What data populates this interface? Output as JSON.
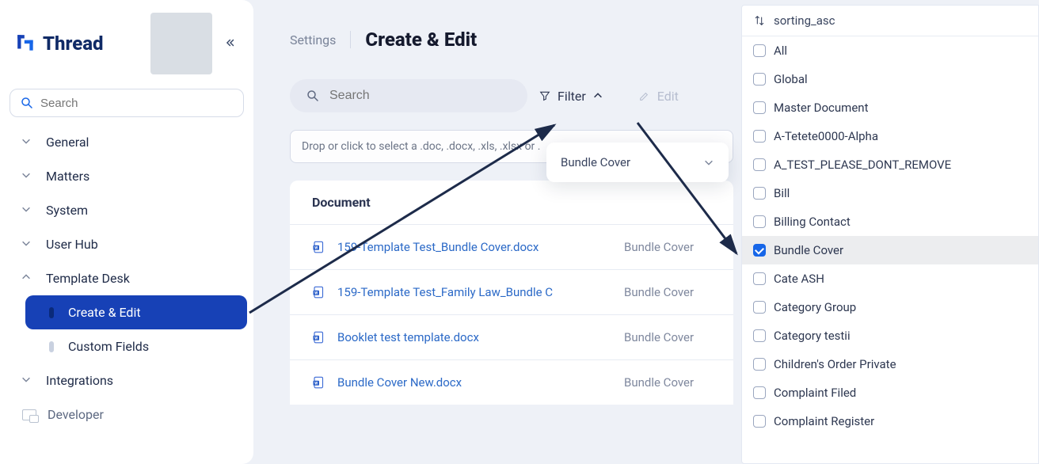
{
  "brand": {
    "name": "Thread"
  },
  "sidebar": {
    "search_placeholder": "Search",
    "items": [
      {
        "label": "General",
        "expanded": false
      },
      {
        "label": "Matters",
        "expanded": false
      },
      {
        "label": "System",
        "expanded": false
      },
      {
        "label": "User Hub",
        "expanded": false
      },
      {
        "label": "Template Desk",
        "expanded": true,
        "children": [
          {
            "label": "Create & Edit",
            "active": true
          },
          {
            "label": "Custom Fields",
            "active": false
          }
        ]
      },
      {
        "label": "Integrations",
        "expanded": false
      },
      {
        "label": "Developer",
        "expanded": false,
        "icon": "developer"
      }
    ]
  },
  "header": {
    "breadcrumb_root": "Settings",
    "page_title": "Create & Edit"
  },
  "toolbar": {
    "search_placeholder": "Search",
    "filter_label": "Filter",
    "edit_label": "Edit"
  },
  "filter_popover": {
    "selected": "Bundle Cover"
  },
  "dropzone": {
    "text": "Drop or click to select a .doc, .docx, .xls, .xlsx or ."
  },
  "table": {
    "header": "Document",
    "rows": [
      {
        "name": "159-Template Test_Bundle Cover.docx",
        "category": "Bundle Cover"
      },
      {
        "name": "159-Template Test_Family Law_Bundle C",
        "category": "Bundle Cover"
      },
      {
        "name": "Booklet test template.docx",
        "category": "Bundle Cover"
      },
      {
        "name": "Bundle Cover New.docx",
        "category": "Bundle Cover"
      }
    ]
  },
  "filter_panel": {
    "sort_label": "sorting_asc",
    "options": [
      {
        "label": "All",
        "checked": false
      },
      {
        "label": "Global",
        "checked": false
      },
      {
        "label": "Master Document",
        "checked": false
      },
      {
        "label": "A-Tetete0000-Alpha",
        "checked": false
      },
      {
        "label": "A_TEST_PLEASE_DONT_REMOVE",
        "checked": false
      },
      {
        "label": "Bill",
        "checked": false
      },
      {
        "label": "Billing Contact",
        "checked": false
      },
      {
        "label": "Bundle Cover",
        "checked": true
      },
      {
        "label": "Cate ASH",
        "checked": false
      },
      {
        "label": "Category Group",
        "checked": false
      },
      {
        "label": "Category testii",
        "checked": false
      },
      {
        "label": "Children's Order Private",
        "checked": false
      },
      {
        "label": "Complaint Filed",
        "checked": false
      },
      {
        "label": "Complaint Register",
        "checked": false
      }
    ]
  }
}
